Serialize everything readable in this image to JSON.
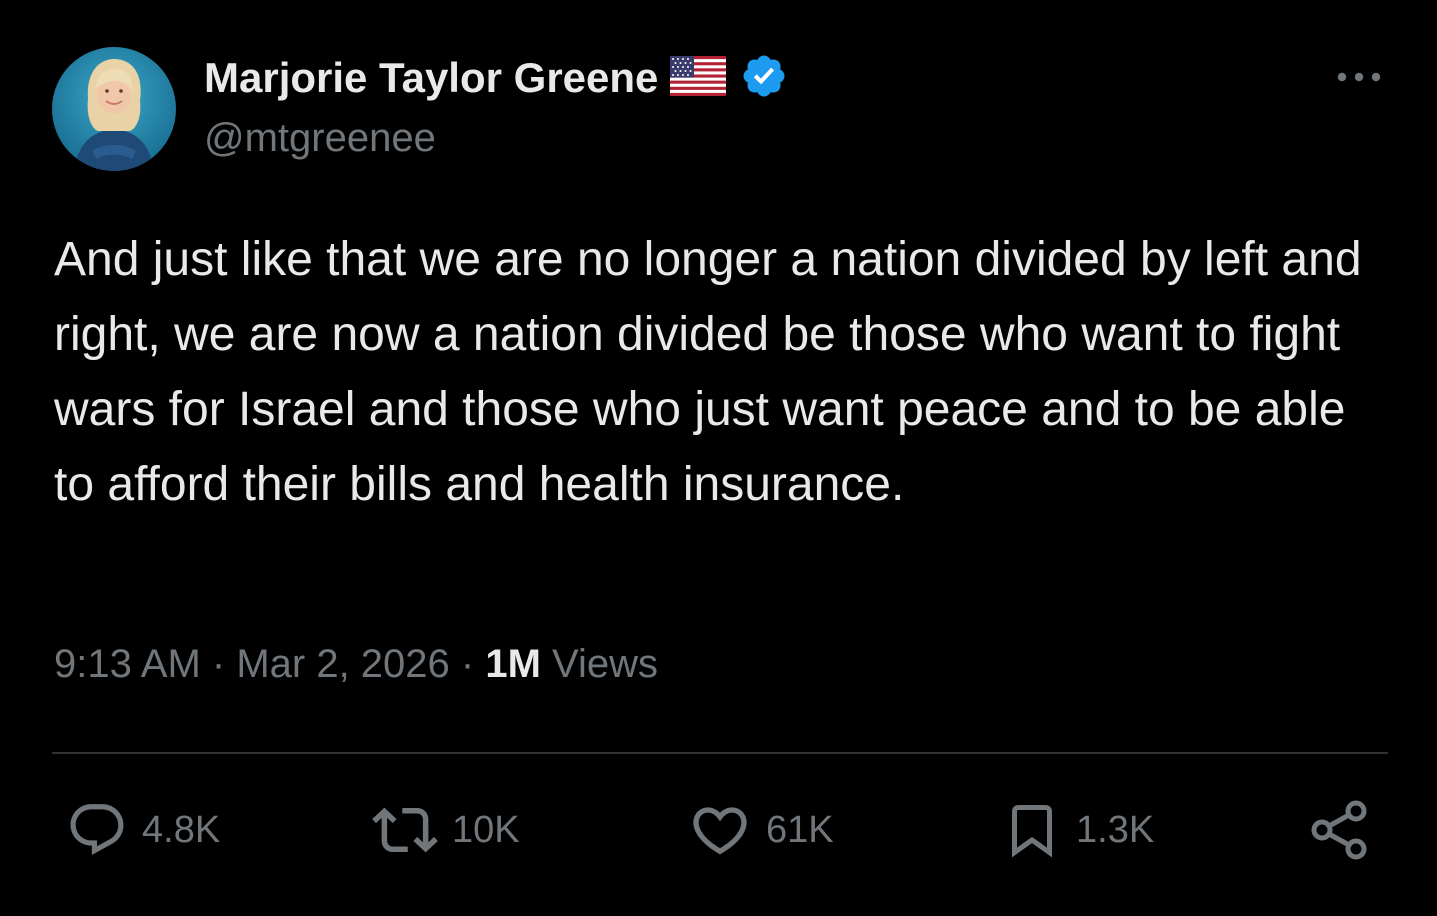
{
  "author": {
    "display_name": "Marjorie Taylor Greene",
    "handle": "@mtgreenee",
    "flag_icon": "us-flag-icon",
    "verified_icon": "verified-badge-icon",
    "verified_color": "#1d9bf0"
  },
  "tweet": {
    "text": "And just like that we are no longer a nation divided by left and right, we are now a nation divided be those who want to fight wars for Israel and those who just want peace and to be able to afford their bills and health insurance.",
    "time": "9:13 AM",
    "date": "Mar 2, 2026",
    "separator": "·",
    "views_count": "1M",
    "views_label": "Views"
  },
  "actions": {
    "reply": {
      "icon": "reply-icon",
      "count": "4.8K"
    },
    "retweet": {
      "icon": "retweet-icon",
      "count": "10K"
    },
    "like": {
      "icon": "heart-icon",
      "count": "61K"
    },
    "bookmark": {
      "icon": "bookmark-icon",
      "count": "1.3K"
    },
    "share": {
      "icon": "share-icon"
    }
  },
  "colors": {
    "background": "#000000",
    "primary_text": "#e7e9ea",
    "secondary_text": "#71767b",
    "divider": "#2f3336",
    "accent": "#1d9bf0"
  }
}
